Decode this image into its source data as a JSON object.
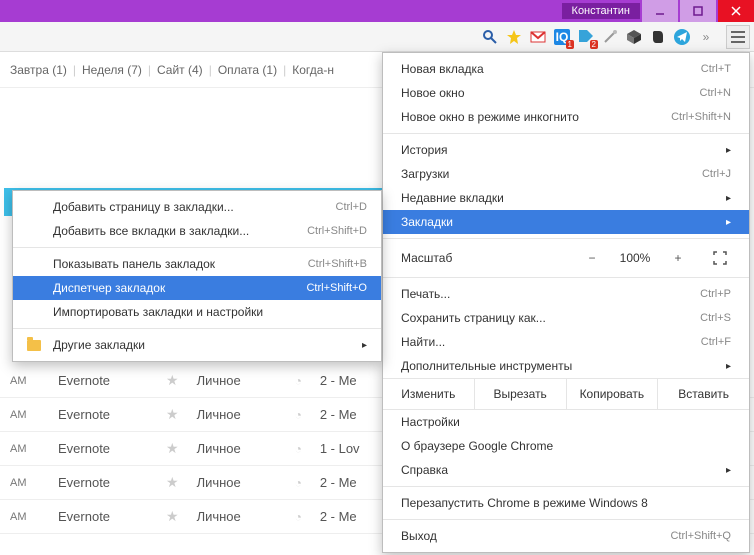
{
  "titlebar": {
    "user": "Константин"
  },
  "tabs": [
    "Завтра (1)",
    "Неделя (7)",
    "Сайт (4)",
    "Оплата (1)",
    "Когда-н"
  ],
  "main_menu": {
    "new_tab": {
      "label": "Новая вкладка",
      "shortcut": "Ctrl+T"
    },
    "new_window": {
      "label": "Новое окно",
      "shortcut": "Ctrl+N"
    },
    "incognito": {
      "label": "Новое окно в режиме инкогнито",
      "shortcut": "Ctrl+Shift+N"
    },
    "history": {
      "label": "История",
      "shortcut": ""
    },
    "downloads": {
      "label": "Загрузки",
      "shortcut": "Ctrl+J"
    },
    "recent_tabs": {
      "label": "Недавние вкладки",
      "shortcut": ""
    },
    "bookmarks": {
      "label": "Закладки",
      "shortcut": ""
    },
    "zoom_label": "Масштаб",
    "zoom_value": "100%",
    "print": {
      "label": "Печать...",
      "shortcut": "Ctrl+P"
    },
    "save_as": {
      "label": "Сохранить страницу как...",
      "shortcut": "Ctrl+S"
    },
    "find": {
      "label": "Найти...",
      "shortcut": "Ctrl+F"
    },
    "more_tools": {
      "label": "Дополнительные инструменты",
      "shortcut": ""
    },
    "edit_label": "Изменить",
    "cut": "Вырезать",
    "copy": "Копировать",
    "paste": "Вставить",
    "settings": {
      "label": "Настройки",
      "shortcut": ""
    },
    "about": {
      "label": "О браузере Google Chrome",
      "shortcut": ""
    },
    "help": {
      "label": "Справка",
      "shortcut": ""
    },
    "relaunch": {
      "label": "Перезапустить Chrome в режиме Windows 8",
      "shortcut": ""
    },
    "exit": {
      "label": "Выход",
      "shortcut": "Ctrl+Shift+Q"
    }
  },
  "bookmark_menu": {
    "add_page": {
      "label": "Добавить страницу в закладки...",
      "shortcut": "Ctrl+D"
    },
    "add_all": {
      "label": "Добавить все вкладки в закладки...",
      "shortcut": "Ctrl+Shift+D"
    },
    "show_bar": {
      "label": "Показывать панель закладок",
      "shortcut": "Ctrl+Shift+B"
    },
    "manager": {
      "label": "Диспетчер закладок",
      "shortcut": "Ctrl+Shift+O"
    },
    "import": {
      "label": "Импортировать закладки и настройки",
      "shortcut": ""
    },
    "other": {
      "label": "Другие закладки",
      "shortcut": ""
    }
  },
  "rows": [
    {
      "time": "AM",
      "app": "Evernote",
      "cat": "Личное",
      "due": "2 - Me"
    },
    {
      "time": "AM",
      "app": "Evernote",
      "cat": "Личное",
      "due": "2 - Me"
    },
    {
      "time": "AM",
      "app": "Evernote",
      "cat": "Личное",
      "due": "1 - Lov"
    },
    {
      "time": "AM",
      "app": "Evernote",
      "cat": "Личное",
      "due": "2 - Me"
    },
    {
      "time": "AM",
      "app": "Evernote",
      "cat": "Личное",
      "due": "2 - Me"
    }
  ],
  "ext_badges": {
    "io": "1",
    "tag": "2"
  }
}
